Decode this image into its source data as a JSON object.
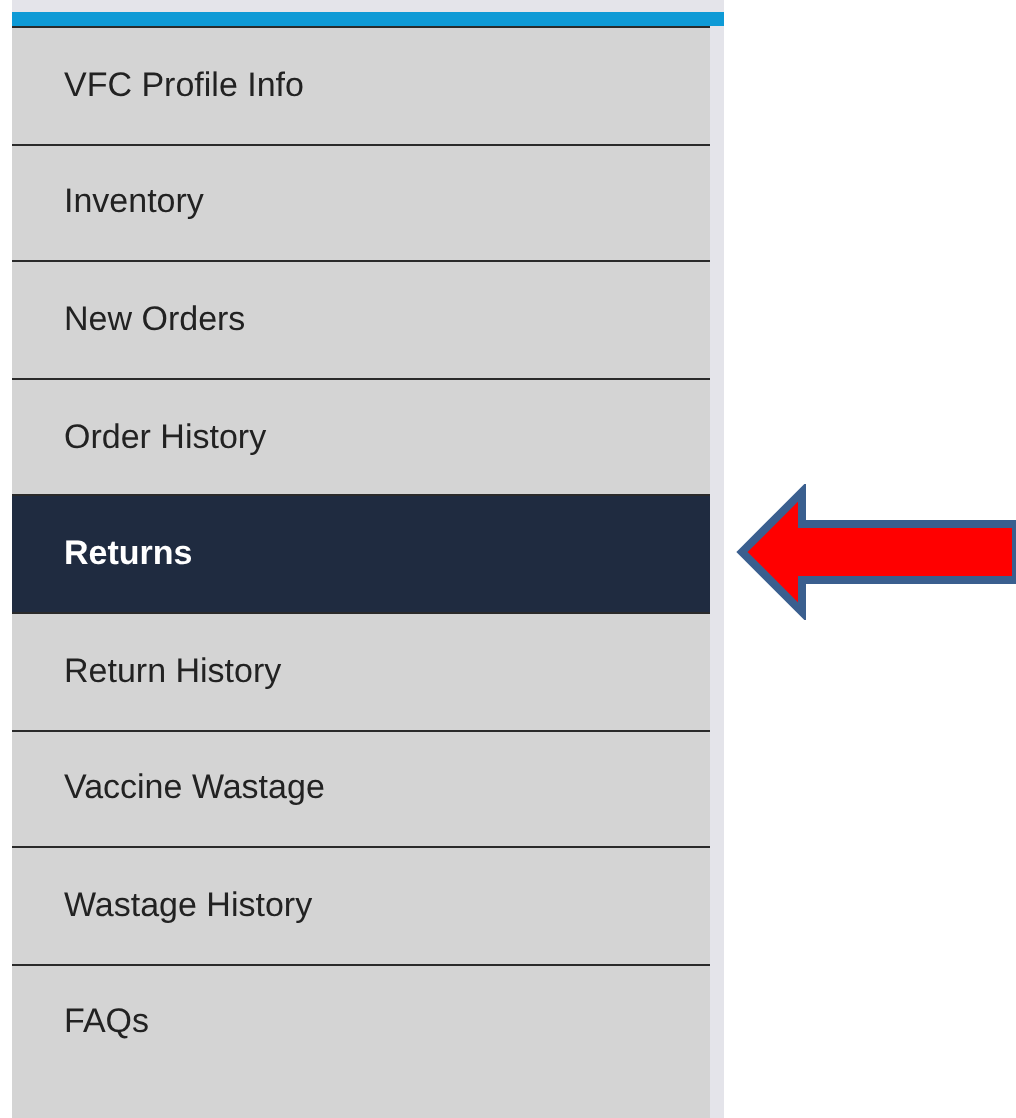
{
  "menu": {
    "items": [
      {
        "label": "VFC Profile Info",
        "selected": false
      },
      {
        "label": "Inventory",
        "selected": false
      },
      {
        "label": "New Orders",
        "selected": false
      },
      {
        "label": "Order History",
        "selected": false
      },
      {
        "label": "Returns",
        "selected": true
      },
      {
        "label": "Return History",
        "selected": false
      },
      {
        "label": "Vaccine Wastage",
        "selected": false
      },
      {
        "label": "Wastage History",
        "selected": false
      },
      {
        "label": "FAQs",
        "selected": false
      }
    ]
  }
}
